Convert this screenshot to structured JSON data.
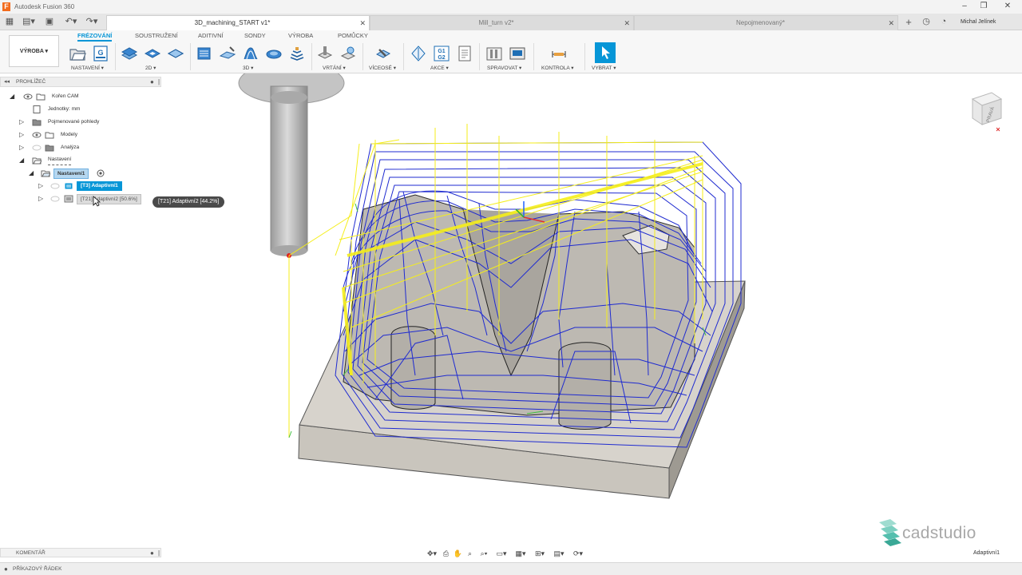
{
  "window": {
    "app_title": "Autodesk Fusion 360",
    "logo_letter": "F",
    "minimize": "–",
    "maximize": "❐",
    "close": "✕"
  },
  "quick_access": {
    "grid": "▦",
    "file": "▤▾",
    "save": "▣",
    "undo": "↶▾",
    "redo": "↷▾"
  },
  "tabs": [
    {
      "label": "3D_machining_START v1*",
      "active": true,
      "close": "✕"
    },
    {
      "label": "Mill_turn v2*",
      "active": false,
      "close": "✕"
    },
    {
      "label": "Nepojmenovaný*",
      "active": false,
      "close": "✕"
    }
  ],
  "tabbar_right": {
    "add": "+",
    "history": "◷",
    "help": "◔",
    "user": "Michal Jelínek"
  },
  "ribbon": {
    "workspace": "VÝROBA ▾",
    "tabs": [
      "FRÉZOVÁNÍ",
      "SOUSTRUŽENÍ",
      "ADITIVNÍ",
      "SONDY",
      "VÝROBA",
      "POMŮCKY"
    ],
    "groups": [
      "NASTAVENÍ ▾",
      "2D ▾",
      "3D ▾",
      "VRTÁNÍ ▾",
      "VÍCEOSÉ ▾",
      "AKCE ▾",
      "SPRAVOVAT ▾",
      "KONTROLA ▾",
      "VYBRAT ▾"
    ],
    "g1g2_label_top": "G1",
    "g1g2_label_bottom": "G2"
  },
  "browser": {
    "title": "PROHLÍŽEČ",
    "collapse": "◂◂",
    "items": [
      {
        "label": "Kořen CAM"
      },
      {
        "label": "Jednotky: mm"
      },
      {
        "label": "Pojmenované pohledy"
      },
      {
        "label": "Modely"
      },
      {
        "label": "Analýza"
      },
      {
        "label": "Nastavení"
      },
      {
        "label": "Nastavení1"
      },
      {
        "label": "[T3] Adaptivní1"
      },
      {
        "label": "[T21] Adaptivní2 [50.6%]"
      }
    ],
    "tooltip": "[T21] Adaptivní2 [44.2%]"
  },
  "viewcube": {
    "face_label": "PRAVÁ"
  },
  "bottom": {
    "comments": "KOMENTÁŘ",
    "command_line": "PŘÍKAZOVÝ ŘÁDEK",
    "status_operation": "Adaptivní1",
    "nav_icons": [
      "✥▾",
      "⎙",
      "✋",
      "⌕",
      "⌕▾",
      "▭▾",
      "▦▾",
      "⊞▾",
      "▤▾",
      "⟳▾"
    ]
  },
  "watermark": {
    "text": "cadstudio"
  },
  "colors": {
    "accent": "#0696d7",
    "toolpath_feed": "#1f2bd0",
    "toolpath_rapid": "#f5ee1a",
    "toolpath_lead": "#3fbf3f",
    "stock": "#c9c5bd",
    "tool": "#bdbdbd"
  }
}
